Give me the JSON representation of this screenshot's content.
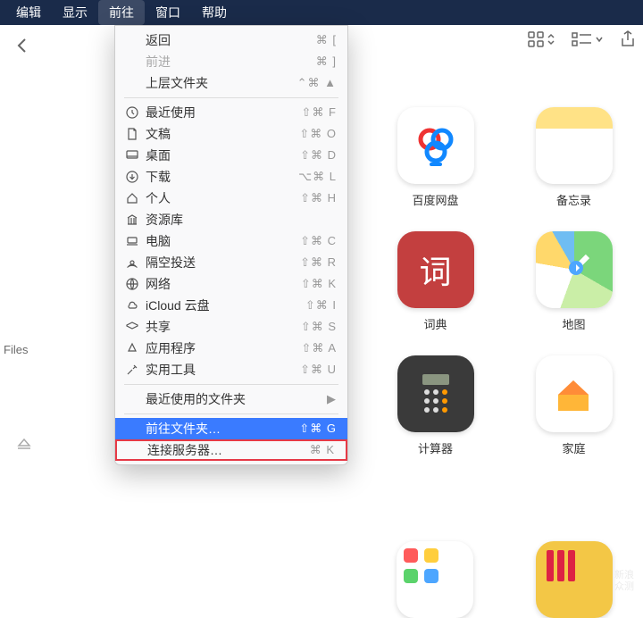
{
  "menubar": {
    "items": [
      "编辑",
      "显示",
      "前往",
      "窗口",
      "帮助"
    ],
    "active_index": 2
  },
  "sidebar": {
    "files_label": "Files"
  },
  "dropdown": {
    "back": {
      "label": "返回",
      "shortcut": "⌘ ["
    },
    "forward": {
      "label": "前进",
      "shortcut": "⌘ ]",
      "disabled": true
    },
    "enclosing": {
      "label": "上层文件夹",
      "shortcut": "⌃⌘ ▲"
    },
    "items": [
      {
        "icon": "clock",
        "label": "最近使用",
        "shortcut": "⇧⌘ F"
      },
      {
        "icon": "doc",
        "label": "文稿",
        "shortcut": "⇧⌘ O"
      },
      {
        "icon": "desktop",
        "label": "桌面",
        "shortcut": "⇧⌘ D"
      },
      {
        "icon": "download",
        "label": "下载",
        "shortcut": "⌥⌘ L"
      },
      {
        "icon": "home",
        "label": "个人",
        "shortcut": "⇧⌘ H"
      },
      {
        "icon": "library",
        "label": "资源库",
        "shortcut": ""
      },
      {
        "icon": "laptop",
        "label": "电脑",
        "shortcut": "⇧⌘ C"
      },
      {
        "icon": "airdrop",
        "label": "隔空投送",
        "shortcut": "⇧⌘ R"
      },
      {
        "icon": "globe",
        "label": "网络",
        "shortcut": "⇧⌘ K"
      },
      {
        "icon": "cloud",
        "label": "iCloud 云盘",
        "shortcut": "⇧⌘ I"
      },
      {
        "icon": "shared",
        "label": "共享",
        "shortcut": "⇧⌘ S"
      },
      {
        "icon": "apps",
        "label": "应用程序",
        "shortcut": "⇧⌘ A"
      },
      {
        "icon": "utilities",
        "label": "实用工具",
        "shortcut": "⇧⌘ U"
      }
    ],
    "recent_folders": {
      "label": "最近使用的文件夹",
      "shortcut": "▶"
    },
    "goto_folder": {
      "label": "前往文件夹…",
      "shortcut": "⇧⌘ G"
    },
    "connect_server": {
      "label": "连接服务器…",
      "shortcut": "⌘ K"
    }
  },
  "apps": [
    {
      "id": "baidu",
      "label": "百度网盘"
    },
    {
      "id": "notes",
      "label": "备忘录"
    },
    {
      "id": "dict",
      "label": "词典",
      "glyph": "词"
    },
    {
      "id": "maps",
      "label": "地图"
    },
    {
      "id": "calc",
      "label": "计算器"
    },
    {
      "id": "home",
      "label": "家庭"
    }
  ],
  "watermark": {
    "l1": "新浪",
    "l2": "众测"
  }
}
